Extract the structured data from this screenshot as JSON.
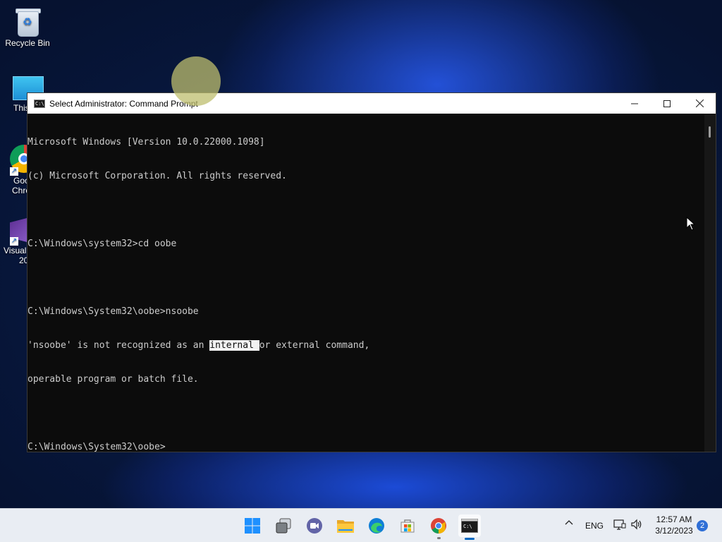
{
  "desktop": {
    "icons": [
      {
        "label": "Recycle Bin"
      },
      {
        "label": "This"
      },
      {
        "label": "Goo"
      },
      {
        "label": "Chro"
      },
      {
        "label": "Visual"
      },
      {
        "label": "20"
      }
    ]
  },
  "window": {
    "title": "Select Administrator: Command Prompt",
    "icon_text": "C:\\",
    "controls": [
      "minimize-icon",
      "maximize-icon",
      "close-icon"
    ]
  },
  "console": {
    "line1": "Microsoft Windows [Version 10.0.22000.1098]",
    "line2": "(c) Microsoft Corporation. All rights reserved.",
    "line3": "",
    "line4": "C:\\Windows\\system32>cd oobe",
    "line5": "",
    "line6": "C:\\Windows\\System32\\oobe>nsoobe",
    "line7_pre": "'nsoobe' is not recognized as an ",
    "line7_sel": "internal ",
    "line7_post": "or external command,",
    "line8": "operable program or batch file.",
    "line9": "",
    "line10": "C:\\Windows\\System32\\oobe>"
  },
  "taskbar": {
    "apps": [
      "start-icon",
      "task-view-icon",
      "teams-chat-icon",
      "file-explorer-icon",
      "edge-icon",
      "store-icon",
      "chrome-icon",
      "terminal-icon"
    ],
    "tray": {
      "chevron": "^",
      "language": "ENG",
      "time": "12:57 AM",
      "date": "3/12/2023",
      "notifications": "2"
    }
  },
  "colors": {
    "console_bg": "#0c0c0c",
    "console_text": "#cccccc",
    "accent": "#0067c0"
  }
}
